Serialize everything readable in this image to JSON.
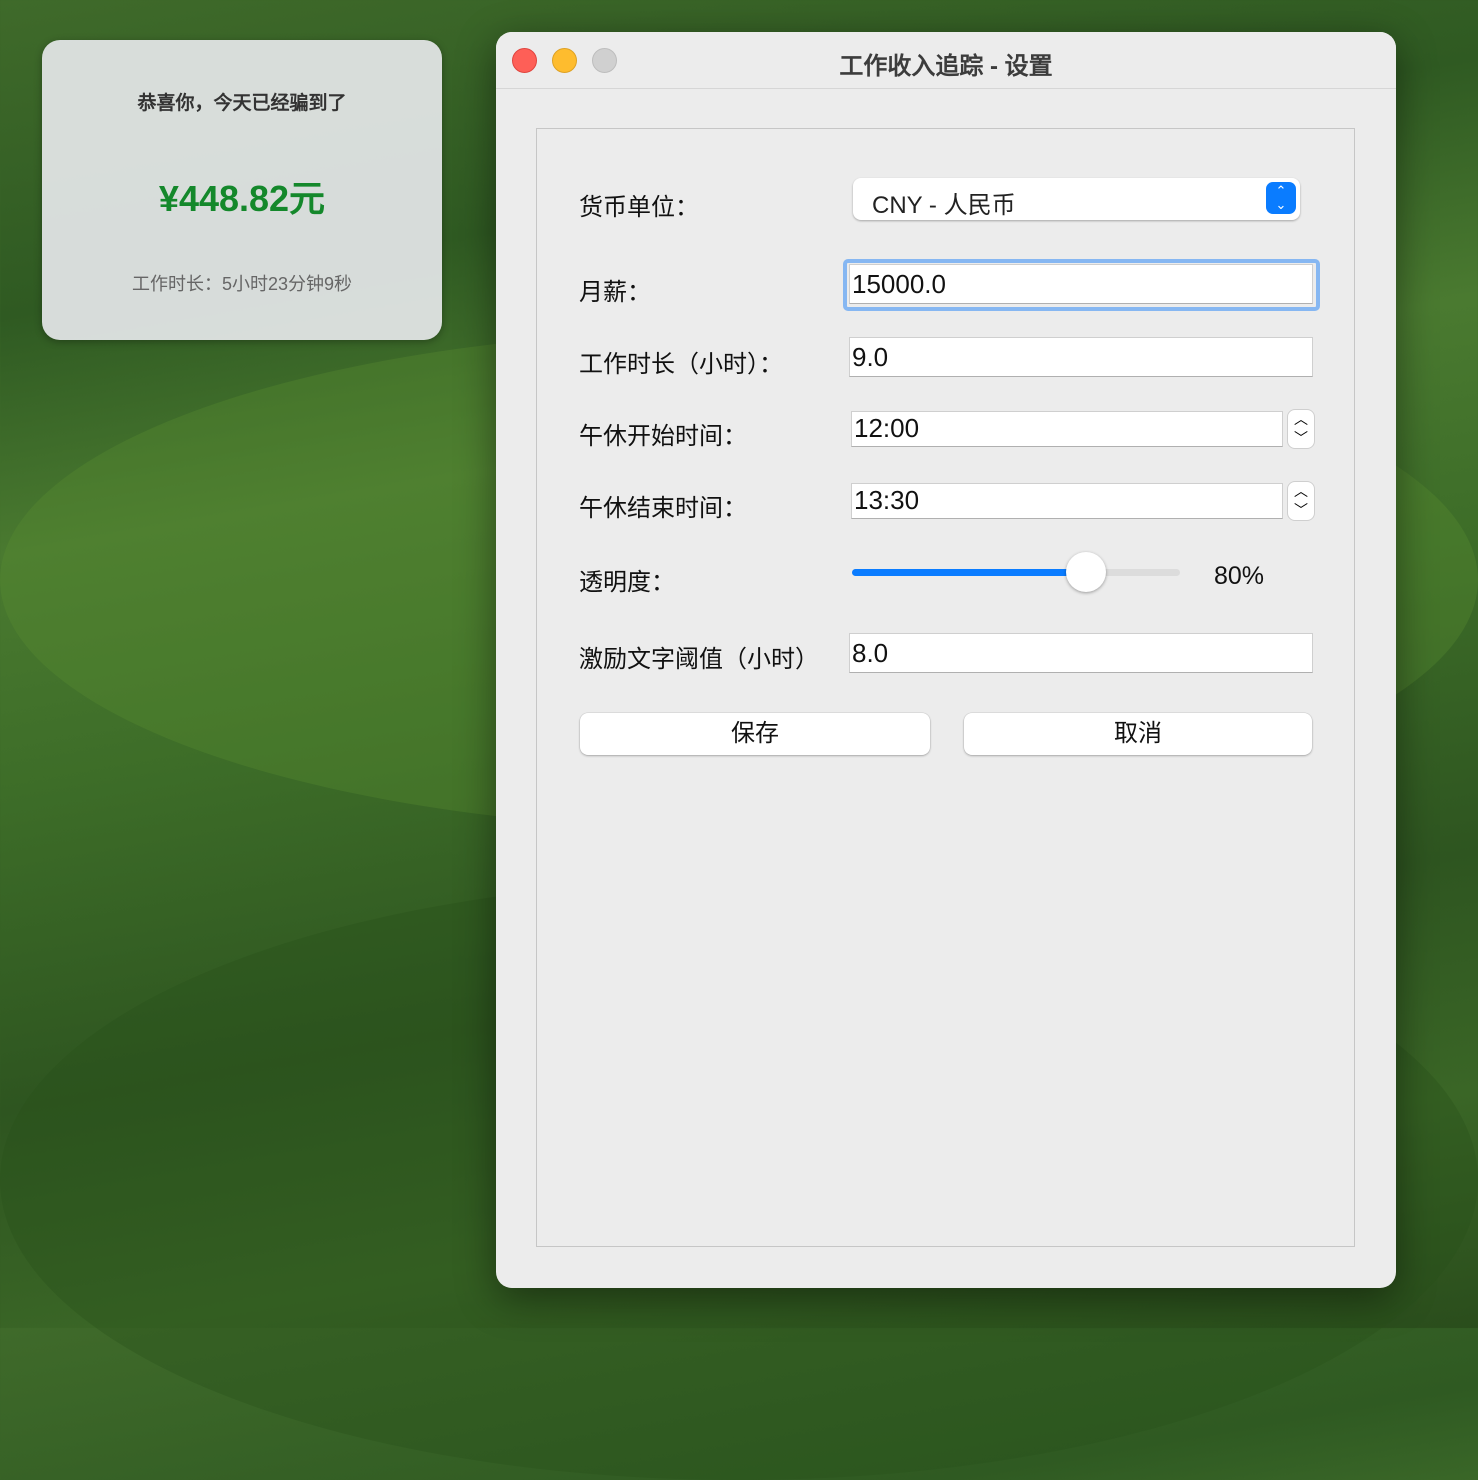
{
  "widget": {
    "title": "恭喜你，今天已经骗到了",
    "amount": "¥448.82元",
    "duration": "工作时长：5小时23分钟9秒",
    "amount_color": "#14882b"
  },
  "window": {
    "title": "工作收入追踪 - 设置"
  },
  "form": {
    "currency": {
      "label": "货币单位：",
      "value": "CNY - 人民币"
    },
    "salary": {
      "label": "月薪：",
      "value": "15000.0"
    },
    "hours": {
      "label": "工作时长（小时）：",
      "value": "9.0"
    },
    "lunch_start": {
      "label": "午休开始时间：",
      "value": "12:00"
    },
    "lunch_end": {
      "label": "午休结束时间：",
      "value": "13:30"
    },
    "opacity": {
      "label": "透明度：",
      "value_text": "80%",
      "value": 80
    },
    "threshold": {
      "label": "激励文字阈值（小时）",
      "value": "8.0"
    },
    "save": "保存",
    "cancel": "取消"
  },
  "colors": {
    "accent": "#0a7cff",
    "focus": "#86b7f2"
  }
}
